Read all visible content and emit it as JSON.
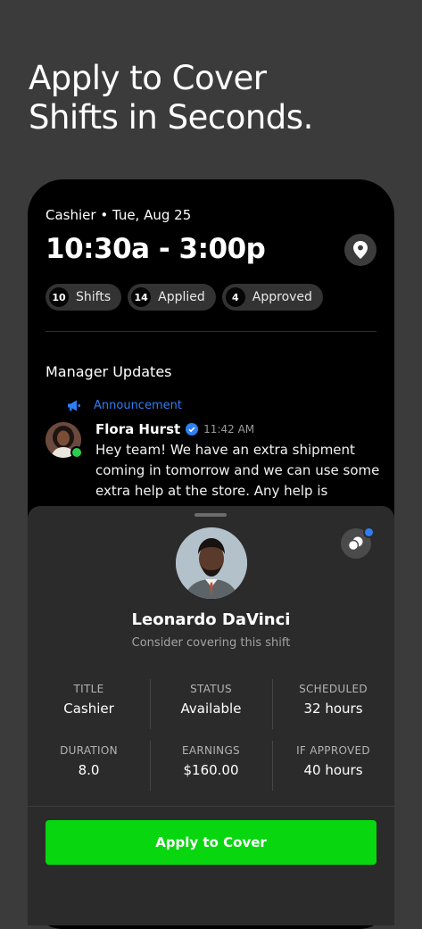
{
  "headline": {
    "line1": "Apply to Cover",
    "line2": "Shifts in Seconds."
  },
  "shift": {
    "subtitle": "Cashier • Tue, Aug 25",
    "time": "10:30a - 3:00p",
    "location_icon": "map-pin-icon"
  },
  "chips": [
    {
      "count": "10",
      "label": "Shifts"
    },
    {
      "count": "14",
      "label": "Applied"
    },
    {
      "count": "4",
      "label": "Approved"
    }
  ],
  "manager_updates": {
    "title": "Manager Updates",
    "announcement_label": "Announcement",
    "announcement_icon": "megaphone-icon",
    "message": {
      "author": "Flora Hurst",
      "time": "11:42 AM",
      "text": "Hey team! We have an extra shipment coming in tomorrow and we can use some extra help at the store. Any help is"
    }
  },
  "sheet": {
    "name": "Leonardo DaVinci",
    "subtitle": "Consider covering this shift",
    "stats_row1": [
      {
        "label": "TITLE",
        "value": "Cashier"
      },
      {
        "label": "STATUS",
        "value": "Available"
      },
      {
        "label": "SCHEDULED",
        "value": "32 hours"
      }
    ],
    "stats_row2": [
      {
        "label": "DURATION",
        "value": "8.0"
      },
      {
        "label": "EARNINGS",
        "value": "$160.00"
      },
      {
        "label": "IF APPROVED",
        "value": "40 hours"
      }
    ],
    "apply_label": "Apply to Cover"
  },
  "colors": {
    "background": "#3b3b3b",
    "card": "#000000",
    "sheet": "#2b2b2b",
    "accent_green": "#08d60f",
    "accent_blue": "#2f7ef5",
    "online": "#2bd04a"
  }
}
